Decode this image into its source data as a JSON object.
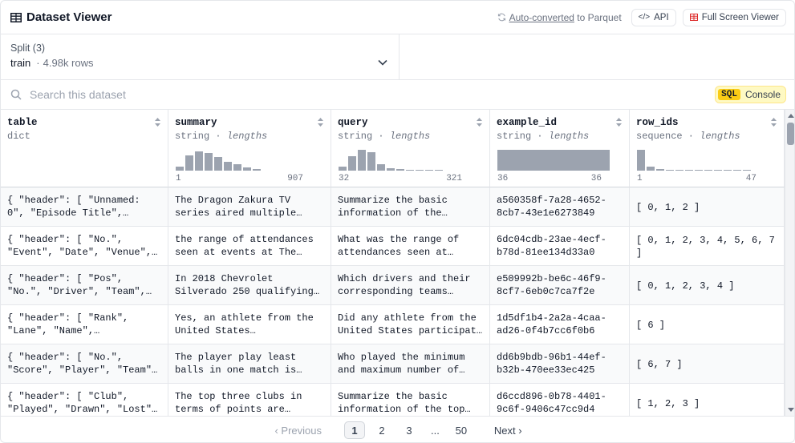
{
  "header": {
    "title": "Dataset Viewer",
    "auto_converted_link": "Auto-converted",
    "auto_converted_rest": " to Parquet",
    "api_label": "API",
    "api_icon": "code-icon",
    "fullscreen_label": "Full Screen Viewer",
    "fullscreen_icon": "table-icon"
  },
  "split": {
    "label": "Split (3)",
    "value": "train",
    "separator": "·",
    "rows": "4.98k rows"
  },
  "search": {
    "placeholder": "Search this dataset",
    "sql_tag": "SQL",
    "console_label": "Console"
  },
  "columns": [
    {
      "name": "table",
      "type": "dict",
      "stat": "",
      "min": "",
      "max": ""
    },
    {
      "name": "summary",
      "type": "string",
      "stat": "lengths",
      "min": "1",
      "max": "907",
      "hist": [
        0.15,
        0.6,
        0.75,
        0.68,
        0.52,
        0.35,
        0.25,
        0.12,
        0.05
      ]
    },
    {
      "name": "query",
      "type": "string",
      "stat": "lengths",
      "min": "32",
      "max": "321",
      "hist": [
        0.15,
        0.55,
        0.8,
        0.72,
        0.25,
        0.08,
        0.05,
        0.03,
        0.03,
        0.02,
        0.02
      ]
    },
    {
      "name": "example_id",
      "type": "string",
      "stat": "lengths",
      "min": "36",
      "max": "36",
      "hist": [
        0.8
      ]
    },
    {
      "name": "row_ids",
      "type": "sequence",
      "stat": "lengths",
      "min": "1",
      "max": "47",
      "hist": [
        0.8,
        0.15,
        0.05,
        0.03,
        0.02,
        0.02,
        0.02,
        0.02,
        0.02,
        0.02,
        0.02,
        0.02
      ]
    }
  ],
  "rows": [
    {
      "table": "{ \"header\": [ \"Unnamed: 0\", \"Episode Title\",…",
      "summary": "The Dragon Zakura TV series aired multiple…",
      "query": "Summarize the basic information of the…",
      "example_id": "a560358f-7a28-4652-8cb7-43e1e6273849",
      "row_ids": "[ 0, 1, 2 ]"
    },
    {
      "table": "{ \"header\": [ \"No.\", \"Event\", \"Date\", \"Venue\",…",
      "summary": "the range of attendances seen at events at The…",
      "query": "What was the range of attendances seen at…",
      "example_id": "6dc04cdb-23ae-4ecf-b78d-81ee134d33a0",
      "row_ids": "[ 0, 1, 2, 3, 4, 5, 6, 7 ]"
    },
    {
      "table": "{ \"header\": [ \"Pos\", \"No.\", \"Driver\", \"Team\",…",
      "summary": "In 2018 Chevrolet Silverado 250 qualifying…",
      "query": "Which drivers and their corresponding teams…",
      "example_id": "e509992b-be6c-46f9-8cf7-6eb0c7ca7f2e",
      "row_ids": "[ 0, 1, 2, 3, 4 ]"
    },
    {
      "table": "{ \"header\": [ \"Rank\", \"Lane\", \"Name\",…",
      "summary": "Yes, an athlete from the United States…",
      "query": "Did any athlete from the United States participat…",
      "example_id": "1d5df1b4-2a2a-4caa-ad26-0f4b7cc6f0b6",
      "row_ids": "[ 6 ]"
    },
    {
      "table": "{ \"header\": [ \"No.\", \"Score\", \"Player\", \"Team\"…",
      "summary": "The player play least balls in one match is…",
      "query": "Who played the minimum and maximum number of…",
      "example_id": "dd6b9bdb-96b1-44ef-b32b-470ee33ec425",
      "row_ids": "[ 6, 7 ]"
    },
    {
      "table": "{ \"header\": [ \"Club\", \"Played\", \"Drawn\", \"Lost\"…",
      "summary": "The top three clubs in terms of points are…",
      "query": "Summarize the basic information of the top…",
      "example_id": "d6ccd896-0b78-4401-9c6f-9406c47cc9d4",
      "row_ids": "[ 1, 2, 3 ]"
    }
  ],
  "pager": {
    "previous": "Previous",
    "pages": [
      "1",
      "2",
      "3"
    ],
    "ellipsis": "...",
    "last": "50",
    "next": "Next",
    "active": "1"
  },
  "colors": {
    "hist_bar": "#9ca3af",
    "sql_bg": "#fef9c3",
    "sql_tag": "#facc15",
    "border": "#e5e7eb"
  }
}
